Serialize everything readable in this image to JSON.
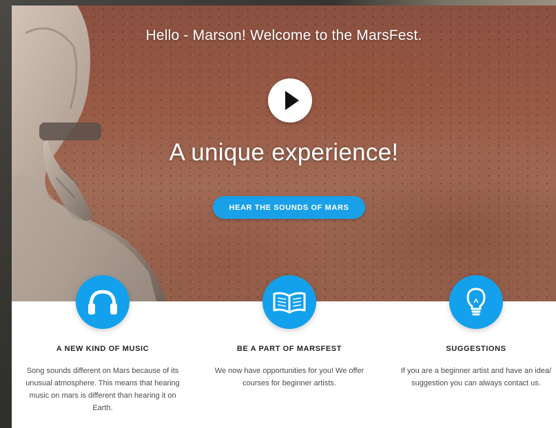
{
  "hero": {
    "greeting": "Hello - Marson! Welcome to the MarsFest.",
    "title": "A unique experience!",
    "cta_label": "HEAR THE SOUNDS OF MARS",
    "play_icon": "play-icon"
  },
  "features": [
    {
      "icon": "headphones-icon",
      "title": "A NEW KIND OF MUSIC",
      "text": "Song sounds different on Mars because of its unusual atmosphere. This means that hearing music on mars is different than hearing it on Earth."
    },
    {
      "icon": "open-book-icon",
      "title": "BE A PART OF MARSFEST",
      "text": "We now have opportunities for you! We offer courses for beginner artists."
    },
    {
      "icon": "lightbulb-icon",
      "title": "SUGGESTIONS",
      "text": "If you are a beginner artist and have an idea/ suggestion you can always contact us."
    }
  ],
  "colors": {
    "accent": "#1aa0e8",
    "hero_tint": "#985a45",
    "text_dark": "#222222",
    "text_body": "#4a4a4a"
  }
}
